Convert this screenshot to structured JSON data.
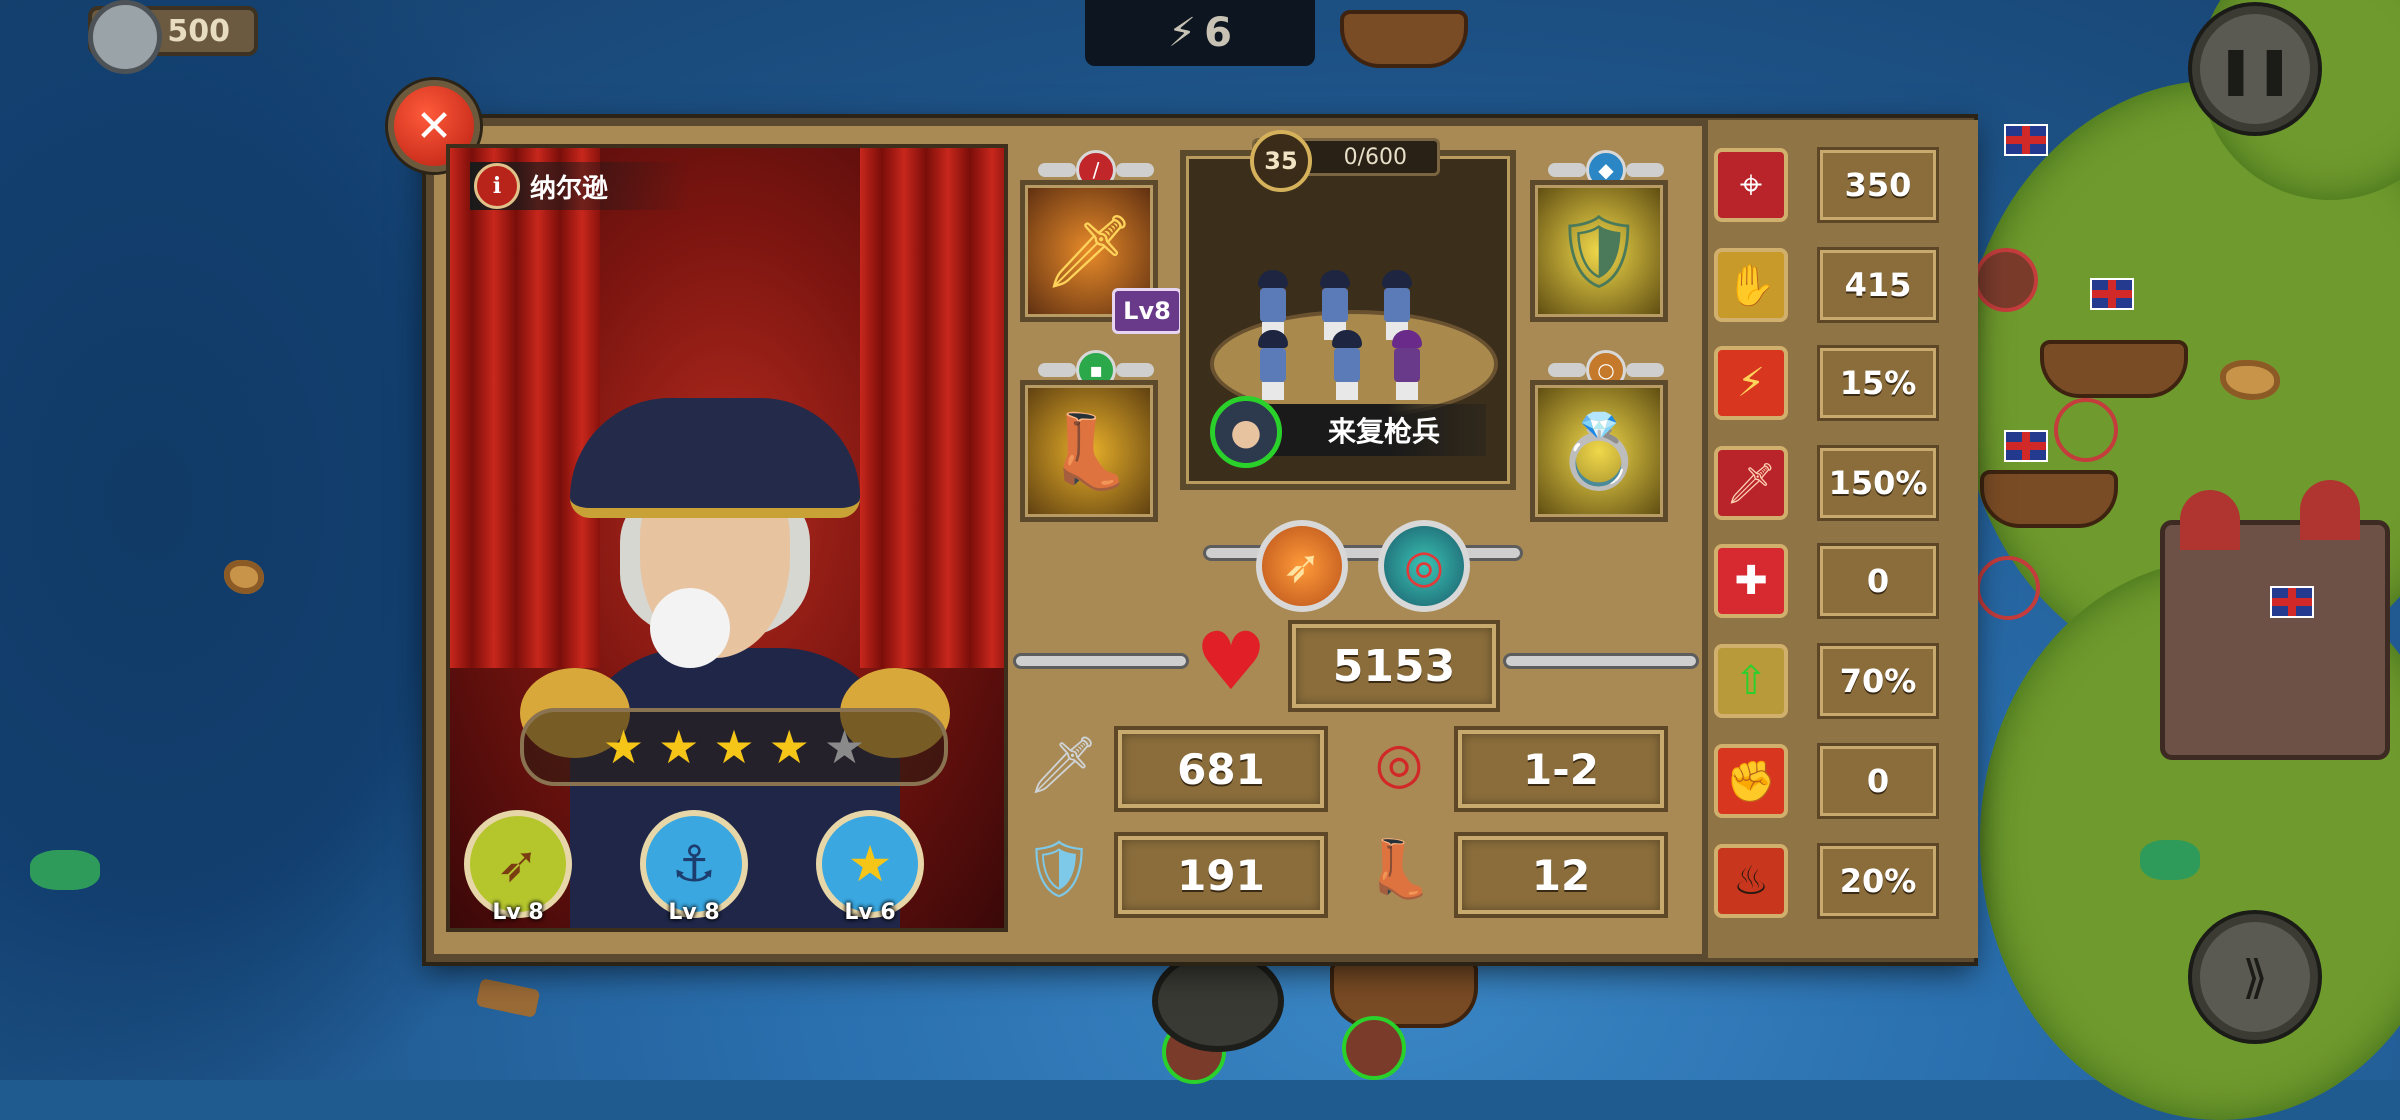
{
  "hud": {
    "coins": "500",
    "wave": "6",
    "pause_icon": "pause-icon",
    "speed_icon": "fast-forward-icon"
  },
  "hero": {
    "name": "纳尔逊",
    "stars_filled": 4,
    "stars_total": 5,
    "skills": [
      {
        "icon": "crossed-arrows-laurel-icon",
        "level": "Lv 8",
        "color": "#b5c62d"
      },
      {
        "icon": "anchor-icon",
        "level": "Lv 8",
        "color": "#3aa7e0"
      },
      {
        "icon": "star-laurel-icon",
        "level": "Lv 6",
        "color": "#3aa7e0"
      }
    ]
  },
  "equipment": {
    "weapon_level": "Lv8",
    "slots": [
      "sword-icon",
      "armor-icon",
      "boots-icon",
      "ring-icon"
    ]
  },
  "troop": {
    "level": "35",
    "exp": "0/600",
    "name": "来复枪兵",
    "abilities": [
      "arrows-icon",
      "target-icon"
    ]
  },
  "stats": {
    "hp": "5153",
    "attack": "681",
    "range": "1-2",
    "defense": "191",
    "speed": "12"
  },
  "side_stats": [
    {
      "icon": "crosshair-icon",
      "value": "350"
    },
    {
      "icon": "quick-hand-icon",
      "value": "415"
    },
    {
      "icon": "lightning-icon",
      "value": "15%"
    },
    {
      "icon": "critical-sword-icon",
      "value": "150%"
    },
    {
      "icon": "medical-cross-icon",
      "value": "0"
    },
    {
      "icon": "rank-up-icon",
      "value": "70%"
    },
    {
      "icon": "fist-icon",
      "value": "0"
    },
    {
      "icon": "burning-figure-icon",
      "value": "20%"
    }
  ]
}
